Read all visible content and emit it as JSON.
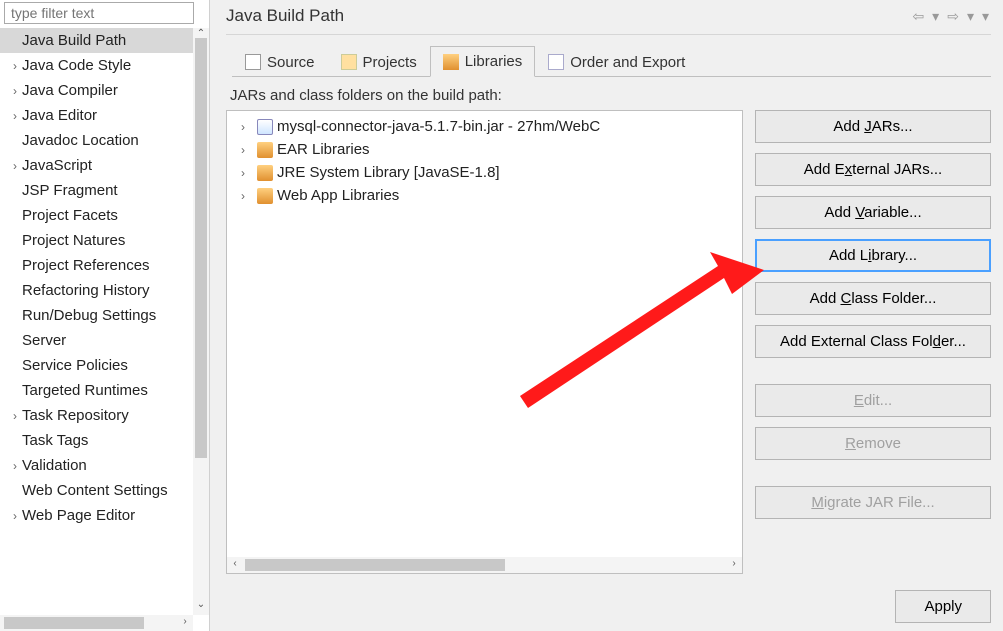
{
  "filter_placeholder": "type filter text",
  "sidebar": {
    "items": [
      {
        "label": "Java Build Path",
        "expandable": false,
        "selected": true
      },
      {
        "label": "Java Code Style",
        "expandable": true
      },
      {
        "label": "Java Compiler",
        "expandable": true
      },
      {
        "label": "Java Editor",
        "expandable": true
      },
      {
        "label": "Javadoc Location",
        "expandable": false
      },
      {
        "label": "JavaScript",
        "expandable": true
      },
      {
        "label": "JSP Fragment",
        "expandable": false
      },
      {
        "label": "Project Facets",
        "expandable": false
      },
      {
        "label": "Project Natures",
        "expandable": false
      },
      {
        "label": "Project References",
        "expandable": false
      },
      {
        "label": "Refactoring History",
        "expandable": false
      },
      {
        "label": "Run/Debug Settings",
        "expandable": false
      },
      {
        "label": "Server",
        "expandable": false
      },
      {
        "label": "Service Policies",
        "expandable": false
      },
      {
        "label": "Targeted Runtimes",
        "expandable": false
      },
      {
        "label": "Task Repository",
        "expandable": true
      },
      {
        "label": "Task Tags",
        "expandable": false
      },
      {
        "label": "Validation",
        "expandable": true
      },
      {
        "label": "Web Content Settings",
        "expandable": false
      },
      {
        "label": "Web Page Editor",
        "expandable": true
      }
    ]
  },
  "page_title": "Java Build Path",
  "tabs": [
    {
      "label": "Source",
      "icon": "source-icon"
    },
    {
      "label": "Projects",
      "icon": "projects-icon"
    },
    {
      "label": "Libraries",
      "icon": "libraries-icon",
      "active": true
    },
    {
      "label": "Order and Export",
      "icon": "order-export-icon"
    }
  ],
  "subtitle": "JARs and class folders on the build path:",
  "libraries": [
    {
      "label": "mysql-connector-java-5.1.7-bin.jar - 27hm/WebC",
      "icon": "jar"
    },
    {
      "label": "EAR Libraries",
      "icon": "lib"
    },
    {
      "label": "JRE System Library [JavaSE-1.8]",
      "icon": "lib"
    },
    {
      "label": "Web App Libraries",
      "icon": "lib"
    }
  ],
  "buttons": {
    "add_jars": "Add JARs...",
    "add_external_jars": "Add External JARs...",
    "add_variable": "Add Variable...",
    "add_library": "Add Library...",
    "add_class_folder": "Add Class Folder...",
    "add_external_class_folder": "Add External Class Folder...",
    "edit": "Edit...",
    "remove": "Remove",
    "migrate": "Migrate JAR File..."
  },
  "apply_label": "Apply"
}
